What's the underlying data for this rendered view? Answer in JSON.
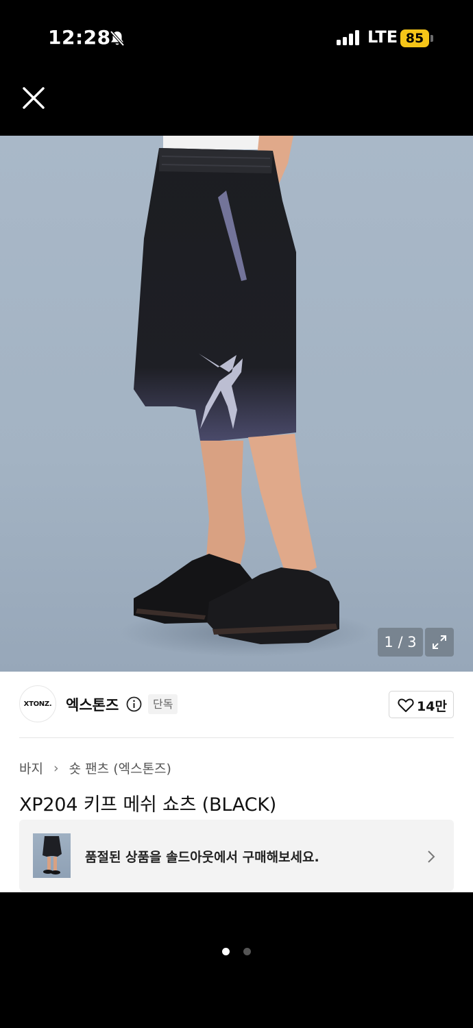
{
  "status_bar": {
    "time": "12:28",
    "network": "LTE",
    "battery": "85"
  },
  "product_image": {
    "counter": "1 / 3"
  },
  "brand": {
    "logo_text": "XTONZ.",
    "name": "엑스톤즈",
    "badge": "단독",
    "likes": "14만"
  },
  "breadcrumb": {
    "category": "바지",
    "subcategory": "숏 팬츠 (엑스톤즈)"
  },
  "product": {
    "title": "XP204 키프 메쉬 쇼츠 (BLACK)"
  },
  "soldout_card": {
    "text": "품절된 상품을 솔드아웃에서 구매해보세요."
  },
  "pager": {
    "pages": 2,
    "active": 0
  },
  "colors": {
    "background": "#000000",
    "image_bg": "#a9b8c8",
    "battery": "#f5c518",
    "card_bg": "#f3f3f3"
  }
}
